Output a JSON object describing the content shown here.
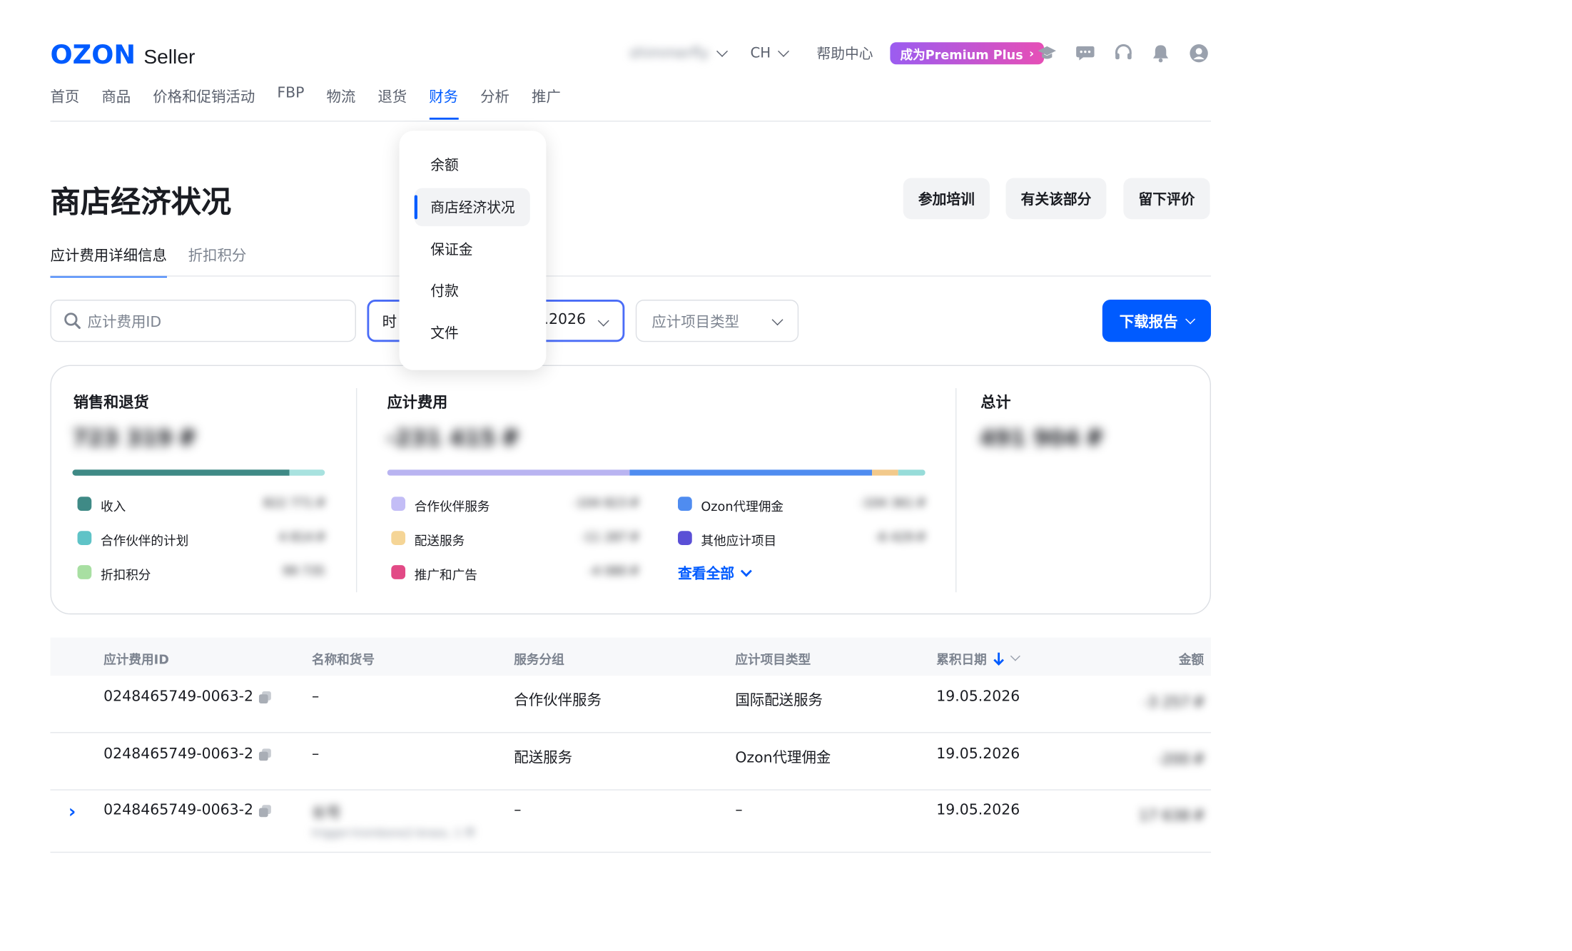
{
  "header": {
    "logo_brand": "OZON",
    "logo_product": "Seller",
    "account_name": "shimmerfly",
    "language": "CH",
    "help_center": "帮助中心",
    "premium_label": "成为Premium Plus",
    "premium_arrow": "›"
  },
  "nav": {
    "items": [
      "首页",
      "商品",
      "价格和促销活动",
      "FBP",
      "物流",
      "退货",
      "财务",
      "分析",
      "推广"
    ],
    "active": "财务"
  },
  "finance_menu": {
    "items": [
      "余额",
      "商店经济状况",
      "保证金",
      "付款",
      "文件"
    ],
    "selected": "商店经济状况"
  },
  "page": {
    "title": "商店经济状况",
    "buttons": {
      "training": "参加培训",
      "about": "有关该部分",
      "feedback": "留下评价"
    },
    "tabs": [
      "应计费用详细信息",
      "折扣积分"
    ]
  },
  "filters": {
    "search_placeholder": "应计费用ID",
    "period_prefix": "时",
    "period_value_suffix": ".2026",
    "type_placeholder": "应计项目类型",
    "download_label": "下载报告"
  },
  "summary": {
    "sales": {
      "title": "销售和退货",
      "total": "723 319 ₽",
      "bar_fractions": [
        0.86,
        0.14
      ],
      "legend": [
        {
          "label": "收入",
          "value": "822 771 ₽",
          "color": "#3f8a86"
        },
        {
          "label": "合作伙伴的计划",
          "value": "4 814 ₽",
          "color": "#5fc3c7"
        },
        {
          "label": "折扣积分",
          "value": "99 735",
          "color": "#a8dfa2"
        }
      ]
    },
    "charges": {
      "title": "应计费用",
      "total": "-231 415 ₽",
      "bar_fractions": [
        0.45,
        0.45,
        0.05,
        0.05
      ],
      "bar_colors": [
        "#b9b4f1",
        "#4f8cf0",
        "#f2c98b",
        "#97dcd9"
      ],
      "legend_left": [
        {
          "label": "合作伙伴服务",
          "value": "-104 823 ₽",
          "color": "#c3bdf6"
        },
        {
          "label": "配送服务",
          "value": "-11 287 ₽",
          "color": "#f5d596"
        },
        {
          "label": "推广和广告",
          "value": "-4 080 ₽",
          "color": "#e24a86"
        }
      ],
      "legend_right": [
        {
          "label": "Ozon代理佣金",
          "value": "-104 361 ₽",
          "color": "#4f8cf0"
        },
        {
          "label": "其他应计项目",
          "value": "-6 429 ₽",
          "color": "#5a4fd6"
        }
      ],
      "see_all": "查看全部"
    },
    "total": {
      "title": "总计",
      "value": "491 904 ₽"
    }
  },
  "table": {
    "headers": {
      "id": "应计费用ID",
      "name": "名称和货号",
      "group": "服务分组",
      "type": "应计项目类型",
      "date": "累积日期",
      "amount": "金额"
    },
    "rows": [
      {
        "id": "0248465749-0063-2",
        "name": "–",
        "group": "合作伙伴服务",
        "type": "国际配送服务",
        "date": "19.05.2026",
        "amount": "-3 257 ₽"
      },
      {
        "id": "0248465749-0063-2",
        "name": "–",
        "group": "配送服务",
        "type": "Ozon代理佣金",
        "date": "19.05.2026",
        "amount": "-200 ₽"
      },
      {
        "id": "0248465749-0063-2",
        "name": "长号",
        "name_sub": "trigger-trombone2-brass, 1 件",
        "group": "–",
        "type": "–",
        "date": "19.05.2026",
        "amount": "17 638 ₽",
        "expandable": true,
        "expand_glyph": "›"
      }
    ]
  }
}
